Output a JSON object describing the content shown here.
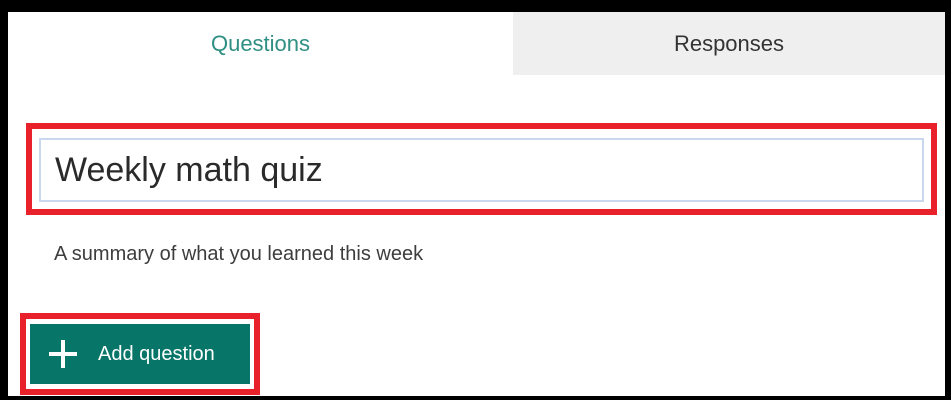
{
  "tabs": [
    {
      "label": "Questions",
      "active": true
    },
    {
      "label": "Responses",
      "active": false
    }
  ],
  "form": {
    "title": "Weekly math quiz",
    "description": "A summary of what you learned this week"
  },
  "actions": {
    "add_question_label": "Add question",
    "add_icon": "plus-icon"
  },
  "colors": {
    "accent": "#077568",
    "active_tab_text": "#2f8f83",
    "inactive_tab_bg": "#efefef",
    "highlight": "#e8212b"
  }
}
